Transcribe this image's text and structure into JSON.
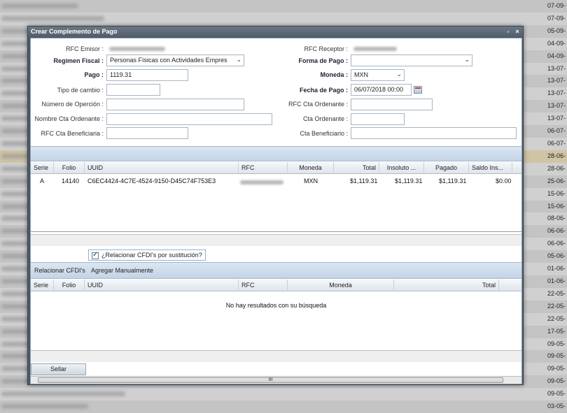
{
  "background": {
    "dates": [
      "07-09-",
      "07-09-",
      "05-09-",
      "04-09-",
      "04-09-",
      "13-07-",
      "13-07-",
      "13-07-",
      "13-07-",
      "13-07-",
      "06-07-",
      "06-07-",
      "28-06-",
      "28-06-",
      "25-06-",
      "15-06-",
      "15-06-",
      "08-06-",
      "06-06-",
      "06-06-",
      "05-06-",
      "01-06-",
      "01-06-",
      "22-05-",
      "22-05-",
      "22-05-",
      "17-05-",
      "09-05-",
      "09-05-",
      "09-05-",
      "09-05-",
      "09-05-",
      "03-05-"
    ],
    "highlight_index": 12
  },
  "window": {
    "title": "Crear Complemento de Pago",
    "minimize_symbol": "▫",
    "close_symbol": "×"
  },
  "form": {
    "rfc_emisor_label": "RFC Emisor :",
    "rfc_receptor_label": "RFC Receptor :",
    "regimen_label": "Regimen Fiscal :",
    "regimen_value": "Personas Físicas con Actividades Empres",
    "forma_pago_label": "Forma de Pago :",
    "forma_pago_value": "",
    "pago_label": "Pago :",
    "pago_value": "1119.31",
    "moneda_label": "Moneda :",
    "moneda_value": "MXN",
    "tipo_cambio_label": "Tipo de cambio :",
    "tipo_cambio_value": "",
    "fecha_pago_label": "Fecha de Pago :",
    "fecha_pago_value": "06/07/2018 00:00",
    "num_operacion_label": "Número de Operción :",
    "rfc_cta_ordenante_label": "RFC Cta Ordenante :",
    "nombre_cta_ordenante_label": "Nombre Cta Ordenante :",
    "cta_ordenante_label": "Cta Ordenante :",
    "rfc_cta_beneficiaria_label": "RFC Cta Beneficiaria :",
    "cta_beneficiario_label": "Cta Beneficiario :"
  },
  "payments_grid": {
    "headers": [
      "Serie",
      "Folio",
      "UUID",
      "RFC",
      "Moneda",
      "Total",
      "Insoluto ...",
      "Pagado",
      "Saldo Ins..."
    ],
    "rows": [
      {
        "serie": "A",
        "folio": "14140",
        "uuid": "C6EC4424-4C7E-4524-9150-D45C74F753E3",
        "moneda": "MXN",
        "total": "$1,119.31",
        "insoluto": "$1,119.31",
        "pagado": "$1,119.31",
        "saldo": "$0.00"
      }
    ]
  },
  "relacionar": {
    "checkbox_label": "¿Relacionar CFDI's por sustitución?",
    "tab_relacionar": "Relacionar CFDI's",
    "tab_agregar": "Agregar Manualmente"
  },
  "related_grid": {
    "headers": [
      "Serie",
      "Folio",
      "UUID",
      "RFC",
      "Moneda",
      "Total"
    ],
    "empty_message": "No hay resultados con su búsqueda"
  },
  "footer": {
    "sellar_label": "Sellar",
    "scroll_grip": "III"
  }
}
